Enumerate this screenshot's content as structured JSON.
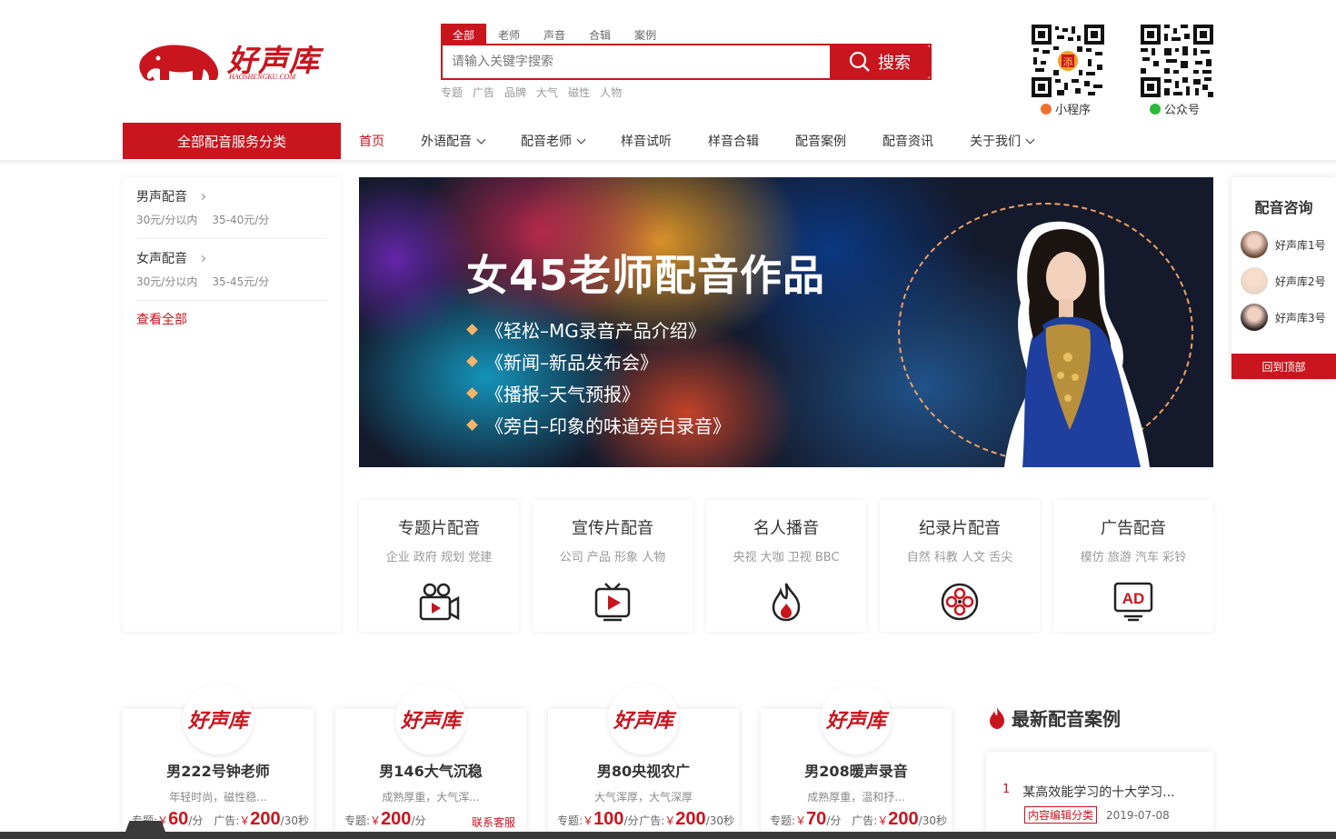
{
  "logo": {
    "text": "好声库",
    "sub": "HAOSHENGKU.COM"
  },
  "search": {
    "tabs": [
      "全部",
      "老师",
      "声音",
      "合辑",
      "案例"
    ],
    "placeholder": "请输入关键字搜索",
    "button": "搜索",
    "hot_words": [
      "专题",
      "广告",
      "品牌",
      "大气",
      "磁性",
      "人物"
    ]
  },
  "qr": [
    {
      "label": "小程序",
      "icon": "miniprogram-icon",
      "color": "#f07030"
    },
    {
      "label": "公众号",
      "icon": "wechat-icon",
      "color": "#2db93b"
    }
  ],
  "nav": {
    "category_button": "全部配音服务分类",
    "items": [
      {
        "label": "首页",
        "active": true,
        "dropdown": false
      },
      {
        "label": "外语配音",
        "dropdown": true
      },
      {
        "label": "配音老师",
        "dropdown": true
      },
      {
        "label": "样音试听",
        "dropdown": false
      },
      {
        "label": "样音合辑",
        "dropdown": false
      },
      {
        "label": "配音案例",
        "dropdown": false
      },
      {
        "label": "配音资讯",
        "dropdown": false
      },
      {
        "label": "关于我们",
        "dropdown": true
      }
    ]
  },
  "sidebar": {
    "groups": [
      {
        "title": "男声配音",
        "subs": [
          "30元/分以内",
          "35-40元/分"
        ]
      },
      {
        "title": "女声配音",
        "subs": [
          "30元/分以内",
          "35-45元/分"
        ]
      }
    ],
    "view_all": "查看全部"
  },
  "banner": {
    "title": "女45老师配音作品",
    "items": [
      "《轻松–MG录音产品介绍》",
      "《新闻–新品发布会》",
      "《播报–天气预报》",
      "《旁白–印象的味道旁白录音》"
    ]
  },
  "categories": [
    {
      "title": "专题片配音",
      "tags": "企业 政府 规划 党建",
      "icon": "video-camera-icon"
    },
    {
      "title": "宣传片配音",
      "tags": "公司 产品 形象 人物",
      "icon": "tv-play-icon"
    },
    {
      "title": "名人播音",
      "tags": "央视 大咖 卫视 BBC",
      "icon": "flame-icon"
    },
    {
      "title": "纪录片配音",
      "tags": "自然 科教 人文 舌尖",
      "icon": "film-reel-icon"
    },
    {
      "title": "广告配音",
      "tags": "模仿 旅游 汽车 彩铃",
      "icon": "ad-screen-icon"
    }
  ],
  "consult": {
    "title": "配音咨询",
    "items": [
      "好声库1号",
      "好声库2号",
      "好声库3号"
    ],
    "back_top": "回到顶部"
  },
  "voice_cards": [
    {
      "logo": "好声库",
      "name": "男222号钟老师",
      "desc": "年轻时尚，磁性稳...",
      "topic_label": "专题:",
      "topic_price": "60",
      "topic_unit": "/分",
      "ad_label": "广告:",
      "ad_price": "200",
      "ad_unit": "/30秒",
      "currency": "￥"
    },
    {
      "logo": "好声库",
      "name": "男146大气沉稳",
      "desc": "成熟厚重，大气浑...",
      "topic_label": "专题:",
      "topic_price": "200",
      "topic_unit": "/分",
      "ad_label": "",
      "ad_price": "",
      "ad_unit": "",
      "currency": "￥",
      "link": "联系客服"
    },
    {
      "logo": "好声库",
      "name": "男80央视农广",
      "desc": "大气浑厚，大气深厚",
      "topic_label": "专题:",
      "topic_price": "100",
      "topic_unit": "/分",
      "ad_label": "广告:",
      "ad_price": "200",
      "ad_unit": "/30秒",
      "currency": "￥"
    },
    {
      "logo": "好声库",
      "name": "男208暖声录音",
      "desc": "成熟厚重，温和抒...",
      "topic_label": "专题:",
      "topic_price": "70",
      "topic_unit": "/分",
      "ad_label": "广告:",
      "ad_price": "200",
      "ad_unit": "/30秒",
      "currency": "￥"
    }
  ],
  "latest_cases": {
    "title": "最新配音案例",
    "items": [
      {
        "num": "1",
        "title": "某高效能学习的十大学习...",
        "tag": "内容编辑分类",
        "date": "2019-07-08"
      }
    ]
  },
  "colors": {
    "brand": "#c9151e"
  }
}
